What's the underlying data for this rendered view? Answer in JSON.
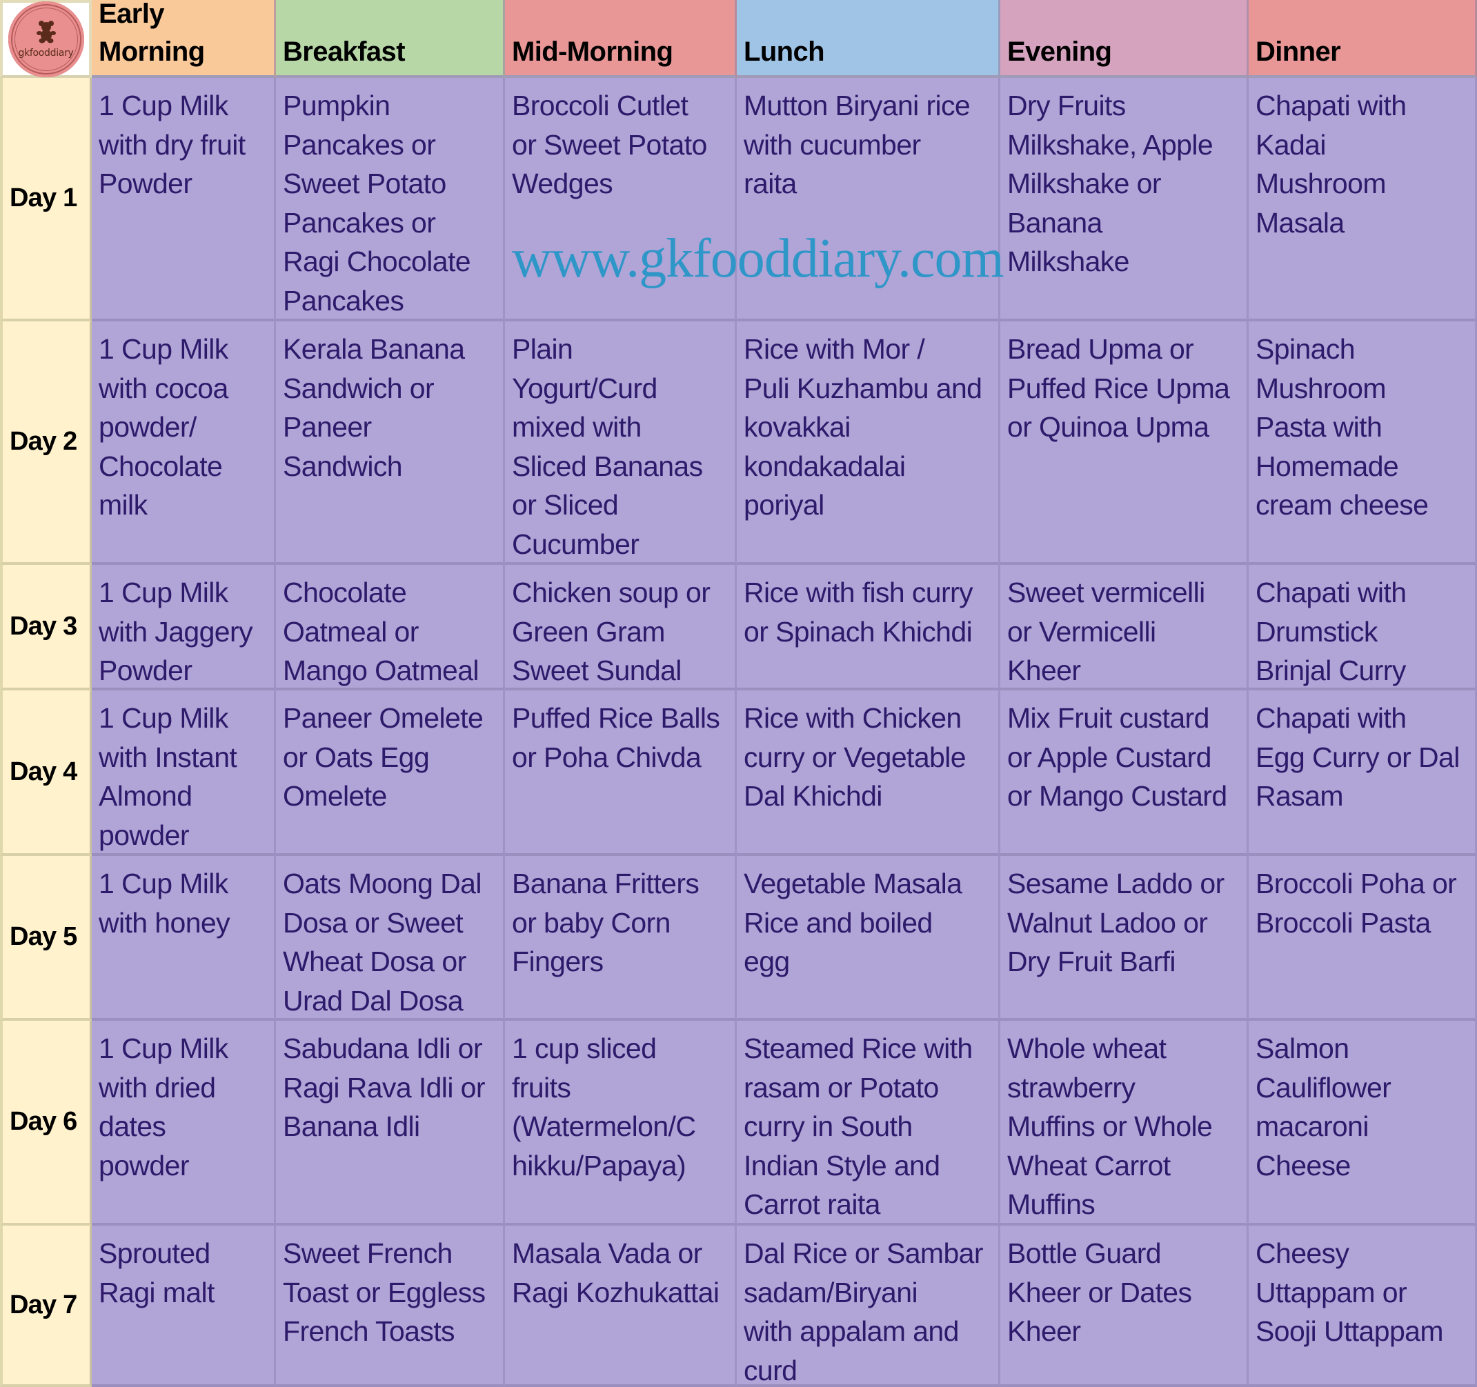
{
  "logo": {
    "text": "gkfooddiary",
    "icon": "teddy-bear-icon"
  },
  "headers": [
    {
      "label": "Early\nMorning",
      "color": "#f9c99a"
    },
    {
      "label": "Breakfast",
      "color": "#b7d7a7"
    },
    {
      "label": "Mid-Morning",
      "color": "#e99696"
    },
    {
      "label": "Lunch",
      "color": "#9fc4e6"
    },
    {
      "label": "Evening",
      "color": "#d6a3bf"
    },
    {
      "label": "Dinner",
      "color": "#e99696"
    }
  ],
  "watermark": "www.gkfooddiary.com",
  "rows": [
    {
      "day": "Day 1",
      "meals": [
        "1 Cup Milk\nwith dry fruit\nPowder",
        "Pumpkin\nPancakes or\nSweet Potato\nPancakes or\nRagi Chocolate\nPancakes",
        "Broccoli Cutlet\nor Sweet Potato\nWedges",
        "Mutton Biryani rice\nwith cucumber\nraita",
        "Dry Fruits\nMilkshake, Apple\nMilkshake or\nBanana\nMilkshake",
        "Chapati with\nKadai\nMushroom\nMasala"
      ]
    },
    {
      "day": "Day 2",
      "meals": [
        "1 Cup Milk\nwith cocoa\npowder/\nChocolate\nmilk",
        "Kerala Banana\nSandwich or\nPaneer\nSandwich",
        "Plain\nYogurt/Curd\nmixed with\nSliced Bananas\nor Sliced\nCucumber",
        "Rice with Mor /\nPuli Kuzhambu and\nkovakkai\nkondakadalai\nporiyal",
        "Bread Upma or\nPuffed Rice Upma\nor Quinoa Upma",
        "Spinach\nMushroom\nPasta with\nHomemade\ncream cheese"
      ]
    },
    {
      "day": "Day 3",
      "meals": [
        "1 Cup Milk\nwith Jaggery\nPowder",
        "Chocolate\nOatmeal or\nMango Oatmeal",
        "Chicken soup or\nGreen Gram\nSweet Sundal",
        "Rice with fish curry\nor Spinach Khichdi",
        "Sweet vermicelli\nor Vermicelli\nKheer",
        "Chapati with\nDrumstick\nBrinjal Curry"
      ]
    },
    {
      "day": "Day 4",
      "meals": [
        "1 Cup Milk\nwith Instant\nAlmond\npowder",
        "Paneer Omelete\nor Oats Egg\nOmelete",
        "Puffed Rice Balls\nor Poha Chivda",
        "Rice with Chicken\ncurry or Vegetable\nDal Khichdi",
        "Mix Fruit custard\nor Apple Custard\nor Mango Custard",
        "Chapati with\nEgg Curry or Dal\nRasam"
      ]
    },
    {
      "day": "Day 5",
      "meals": [
        "1 Cup Milk\nwith honey",
        "Oats Moong Dal\nDosa or Sweet\nWheat Dosa or\nUrad Dal Dosa",
        "Banana Fritters\nor baby Corn\nFingers",
        "Vegetable Masala\nRice and boiled\negg",
        "Sesame Laddo or\nWalnut Ladoo or\nDry Fruit Barfi",
        "Broccoli Poha or\nBroccoli Pasta"
      ]
    },
    {
      "day": "Day 6",
      "meals": [
        "1 Cup Milk\nwith dried\ndates\npowder",
        "Sabudana Idli or\nRagi Rava Idli or\nBanana Idli",
        "1 cup sliced\nfruits\n(Watermelon/C\nhikku/Papaya)",
        "Steamed Rice with\nrasam or Potato\ncurry in South\nIndian Style and\nCarrot raita",
        "Whole wheat\nstrawberry\nMuffins or Whole\nWheat Carrot\nMuffins",
        "Salmon\nCauliflower\nmacaroni\nCheese"
      ]
    },
    {
      "day": "Day 7",
      "meals": [
        "Sprouted\nRagi malt",
        "Sweet French\nToast or Eggless\nFrench Toasts",
        "Masala Vada or\nRagi Kozhukattai",
        "Dal Rice or Sambar\nsadam/Biryani\nwith appalam and\ncurd",
        "Bottle Guard\nKheer or Dates\nKheer",
        "Cheesy\nUttappam or\nSooji Uttappam"
      ]
    }
  ]
}
